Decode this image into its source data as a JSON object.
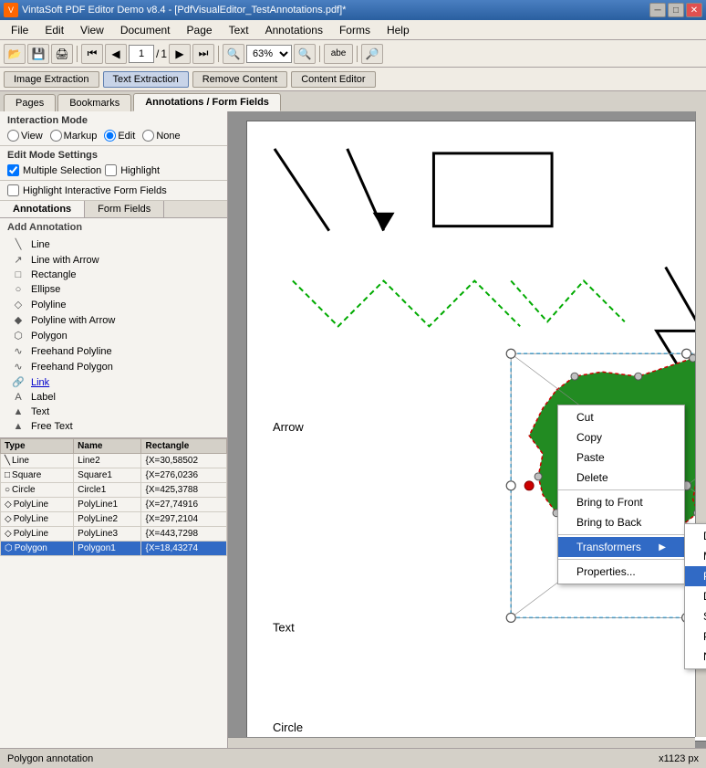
{
  "titlebar": {
    "title": "VintaSoft PDF Editor Demo v8.4 - [PdfVisualEditor_TestAnnotations.pdf]*",
    "icon": "V"
  },
  "menubar": {
    "items": [
      "File",
      "Edit",
      "View",
      "Document",
      "Page",
      "Text",
      "Annotations",
      "Forms",
      "Help"
    ]
  },
  "toolbar": {
    "page_current": "1",
    "page_separator": "/",
    "page_total": "1",
    "zoom_value": "63%",
    "zoom_label": "63%"
  },
  "subtoolbar": {
    "image_extraction": "Image Extraction",
    "text_extraction": "Text Extraction",
    "remove_content": "Remove Content",
    "content_editor": "Content Editor"
  },
  "tabs": {
    "pages": "Pages",
    "bookmarks": "Bookmarks",
    "annotations": "Annotations / Form Fields"
  },
  "interaction_mode": {
    "label": "Interaction Mode",
    "options": [
      "View",
      "Markup",
      "Edit",
      "None"
    ],
    "selected": "Edit"
  },
  "edit_mode": {
    "label": "Edit Mode Settings",
    "multiple_selection": "Multiple Selection",
    "highlight": "Highlight"
  },
  "highlight_interactive": "Highlight Interactive Form Fields",
  "ann_tabs": {
    "annotations": "Annotations",
    "form_fields": "Form Fields"
  },
  "add_annotation": {
    "label": "Add Annotation",
    "items": [
      {
        "icon": "\\",
        "label": "Line"
      },
      {
        "icon": "↗",
        "label": "Line with Arrow"
      },
      {
        "icon": "□",
        "label": "Rectangle"
      },
      {
        "icon": "○",
        "label": "Ellipse"
      },
      {
        "icon": "◇",
        "label": "Polyline"
      },
      {
        "icon": "◆",
        "label": "Polyline with Arrow"
      },
      {
        "icon": "⬠",
        "label": "Polygon"
      },
      {
        "icon": "∿",
        "label": "Freehand Polyline"
      },
      {
        "icon": "∿",
        "label": "Freehand Polygon"
      },
      {
        "icon": "🔗",
        "label": "Link"
      },
      {
        "icon": "A",
        "label": "Label"
      },
      {
        "icon": "A",
        "label": "Text"
      },
      {
        "icon": "A",
        "label": "Free Text"
      }
    ]
  },
  "annotation_table": {
    "columns": [
      "Type",
      "Name",
      "Rectangle"
    ],
    "rows": [
      {
        "type": "Line",
        "name": "Line2",
        "rect": "{X=30,58502",
        "icon": "line"
      },
      {
        "type": "Square",
        "name": "Square1",
        "rect": "{X=276,0236",
        "icon": "rect"
      },
      {
        "type": "Circle",
        "name": "Circle1",
        "rect": "{X=425,3788",
        "icon": "circle"
      },
      {
        "type": "PolyLine",
        "name": "PolyLine1",
        "rect": "{X=27,74916",
        "icon": "poly"
      },
      {
        "type": "PolyLine",
        "name": "PolyLine2",
        "rect": "{X=297,2104",
        "icon": "poly"
      },
      {
        "type": "PolyLine",
        "name": "PolyLine3",
        "rect": "{X=443,7298",
        "icon": "poly"
      },
      {
        "type": "Polygon",
        "name": "Polygon1",
        "rect": "{X=18,43274",
        "icon": "polygon",
        "selected": true
      }
    ]
  },
  "context_menu": {
    "items": [
      {
        "label": "Cut",
        "action": "cut"
      },
      {
        "label": "Copy",
        "action": "copy"
      },
      {
        "label": "Paste",
        "action": "paste"
      },
      {
        "label": "Delete",
        "action": "delete"
      },
      {
        "separator": true
      },
      {
        "label": "Bring to Front",
        "action": "bring-front"
      },
      {
        "label": "Bring to Back",
        "action": "bring-back"
      },
      {
        "separator": true
      },
      {
        "label": "Transformers",
        "action": "transformers",
        "has_submenu": true
      },
      {
        "separator": false
      },
      {
        "label": "Properties...",
        "action": "properties"
      }
    ]
  },
  "submenu": {
    "items": [
      {
        "label": "Default",
        "action": "default"
      },
      {
        "label": "Move/Resize/Rotate",
        "action": "move-resize-rotate"
      },
      {
        "label": "Points/Move/Resize/Rotate",
        "action": "points-move-resize-rotate",
        "highlighted": true
      },
      {
        "label": "Distortion",
        "action": "distortion"
      },
      {
        "label": "Skew",
        "action": "skew"
      },
      {
        "label": "Points",
        "action": "points"
      },
      {
        "label": "None",
        "action": "none"
      }
    ]
  },
  "status_bar": {
    "text": "Polygon annotation",
    "dimensions": "x1123 px"
  },
  "canvas": {
    "annotations": {
      "arrow_label": "Arrow",
      "text_label": "Text",
      "circle_label": "Circle"
    }
  }
}
